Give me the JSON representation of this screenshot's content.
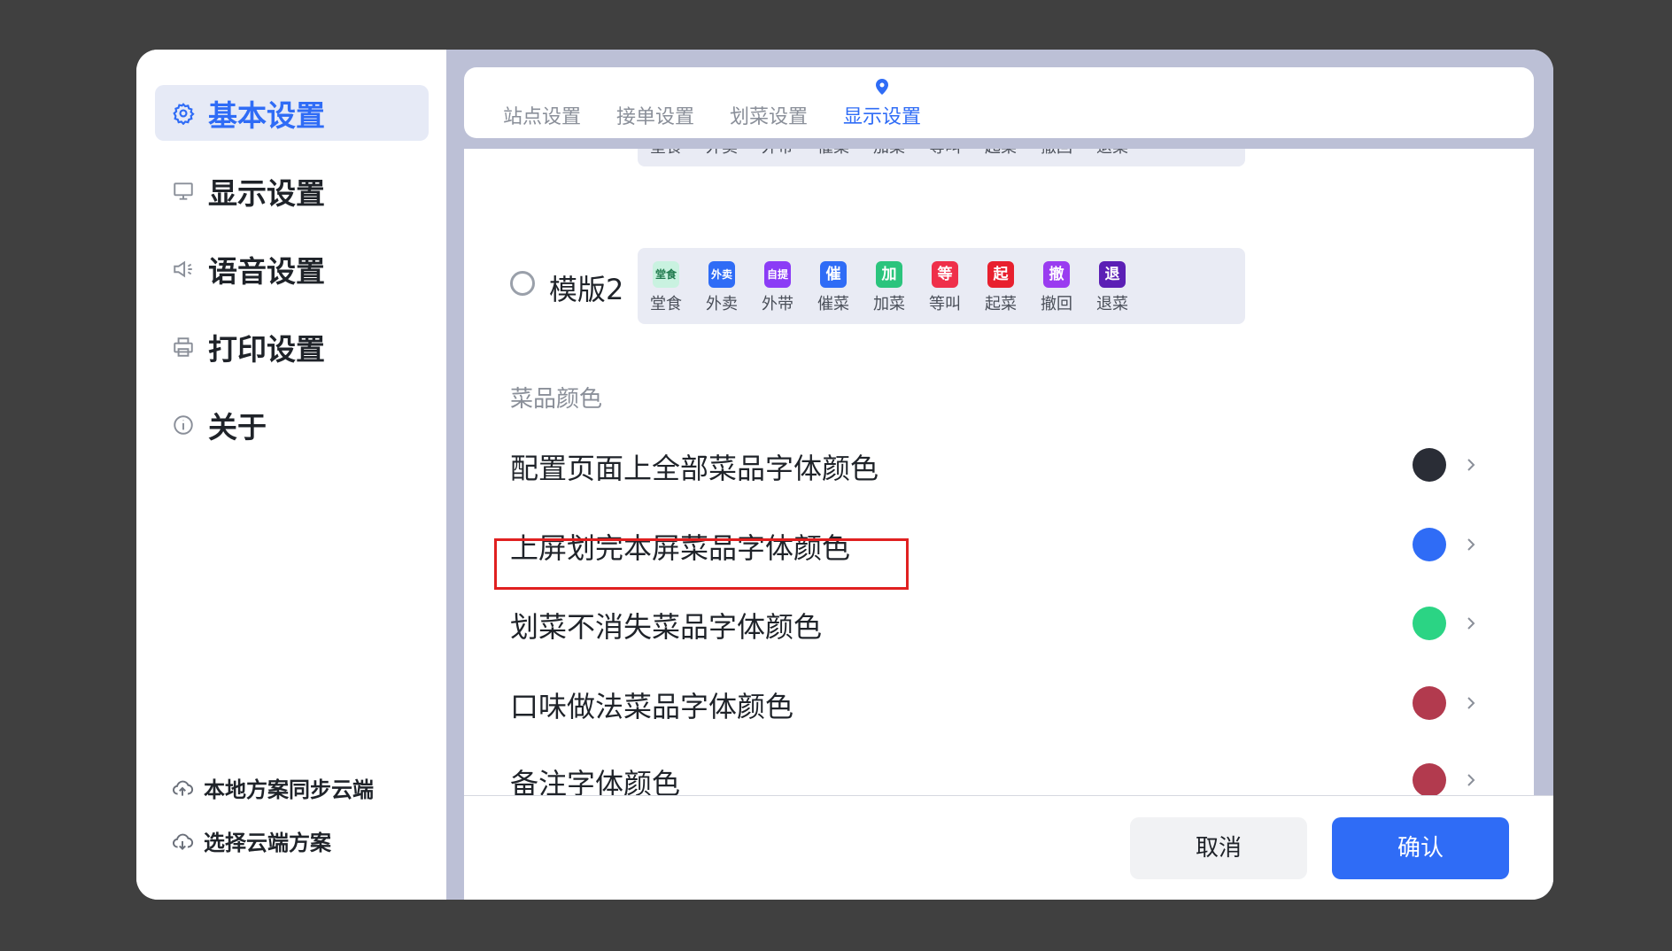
{
  "sidebar": {
    "items": [
      {
        "label": "基本设置",
        "icon": "gear-icon",
        "active": true
      },
      {
        "label": "显示设置",
        "icon": "monitor-icon"
      },
      {
        "label": "语音设置",
        "icon": "speaker-icon"
      },
      {
        "label": "打印设置",
        "icon": "printer-icon"
      },
      {
        "label": "关于",
        "icon": "info-icon"
      }
    ],
    "cloud_links": [
      {
        "label": "本地方案同步云端",
        "icon": "cloud-upload-icon"
      },
      {
        "label": "选择云端方案",
        "icon": "cloud-download-icon"
      }
    ]
  },
  "tabs": [
    {
      "label": "站点设置"
    },
    {
      "label": "接单设置"
    },
    {
      "label": "划菜设置"
    },
    {
      "label": "显示设置",
      "active": true
    }
  ],
  "templates": [
    {
      "name": "",
      "badges": [
        {
          "label": "堂食"
        },
        {
          "label": "外卖"
        },
        {
          "label": "外带"
        },
        {
          "label": "催菜"
        },
        {
          "label": "加菜"
        },
        {
          "label": "等叫"
        },
        {
          "label": "起菜"
        },
        {
          "label": "撤回"
        },
        {
          "label": "退菜"
        }
      ]
    },
    {
      "name": "模版2",
      "badges": [
        {
          "glyph": "堂食",
          "label": "堂食",
          "color": "#c9f2e0",
          "text_color": "#1f7a4d"
        },
        {
          "glyph": "外卖",
          "label": "外卖",
          "color": "#2f6cf6"
        },
        {
          "glyph": "自提",
          "label": "外带",
          "color": "#8b3cf6"
        },
        {
          "glyph": "催",
          "label": "催菜",
          "color": "#2f6cf6"
        },
        {
          "glyph": "加",
          "label": "加菜",
          "color": "#2bc47d"
        },
        {
          "glyph": "等",
          "label": "等叫",
          "color": "#ef2f4a"
        },
        {
          "glyph": "起",
          "label": "起菜",
          "color": "#e8202e"
        },
        {
          "glyph": "撤",
          "label": "撤回",
          "color": "#9a3cf0"
        },
        {
          "glyph": "退",
          "label": "退菜",
          "color": "#5b1fb5"
        }
      ]
    }
  ],
  "section_title": "菜品颜色",
  "color_settings": [
    {
      "label": "配置页面上全部菜品字体颜色",
      "color": "#2a2d36"
    },
    {
      "label": "上屏划完本屏菜品字体颜色",
      "color": "#2f6cf6"
    },
    {
      "label": "划菜不消失菜品字体颜色",
      "color": "#2bd484"
    },
    {
      "label": "口味做法菜品字体颜色",
      "color": "#b23a4e"
    },
    {
      "label": "备注字体颜色",
      "color": "#b23a4e"
    }
  ],
  "footer": {
    "cancel_label": "取消",
    "confirm_label": "确认"
  }
}
